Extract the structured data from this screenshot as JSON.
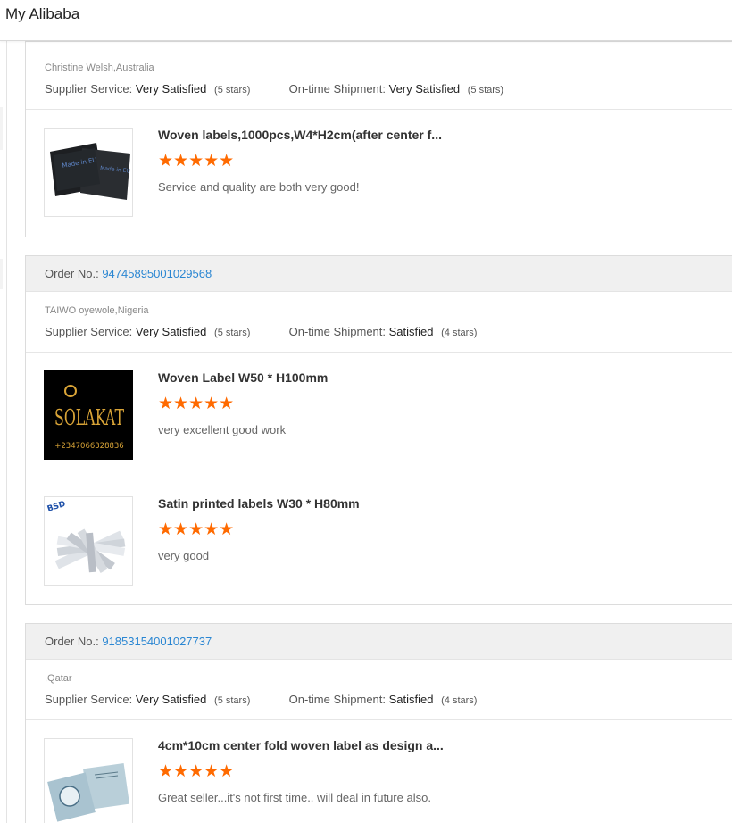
{
  "header": {
    "title": "My Alibaba"
  },
  "labels": {
    "order_no": "Order No.:",
    "supplier_service": "Supplier Service:",
    "ontime_shipment": "On-time Shipment:"
  },
  "reviews": [
    {
      "order_no": "",
      "buyer": "Christine Welsh,Australia",
      "supplier_service": "Very Satisfied",
      "supplier_stars": "(5 stars)",
      "shipment": "Very Satisfied",
      "shipment_stars": "(5 stars)",
      "items": [
        {
          "name": "Woven labels,1000pcs,W4*H2cm(after center f...",
          "stars": "★★★★★",
          "comment": "Service and quality are both very good!",
          "thumb_label": "Made in EU"
        }
      ]
    },
    {
      "order_no": "94745895001029568",
      "buyer": "TAIWO oyewole,Nigeria",
      "supplier_service": "Very Satisfied",
      "supplier_stars": "(5 stars)",
      "shipment": "Satisfied",
      "shipment_stars": "(4 stars)",
      "items": [
        {
          "name": "Woven Label W50 * H100mm",
          "stars": "★★★★★",
          "comment": "very excellent good work",
          "thumb_label": "SOLAKAT",
          "thumb_sub": "+2347066328836"
        },
        {
          "name": "Satin printed labels W30 * H80mm",
          "stars": "★★★★★",
          "comment": "very good",
          "thumb_label": "BSD"
        }
      ]
    },
    {
      "order_no": "91853154001027737",
      "buyer": ",Qatar",
      "supplier_service": "Very Satisfied",
      "supplier_stars": "(5 stars)",
      "shipment": "Satisfied",
      "shipment_stars": "(4 stars)",
      "items": [
        {
          "name": "4cm*10cm center fold woven label as design a...",
          "stars": "★★★★★",
          "comment": "Great seller...it's not first time.. will deal in future also.",
          "thumb_label": ""
        }
      ]
    }
  ],
  "colors": {
    "star": "#ff6a00",
    "link": "#2a86d2",
    "header_bg": "#f0f0f0"
  }
}
